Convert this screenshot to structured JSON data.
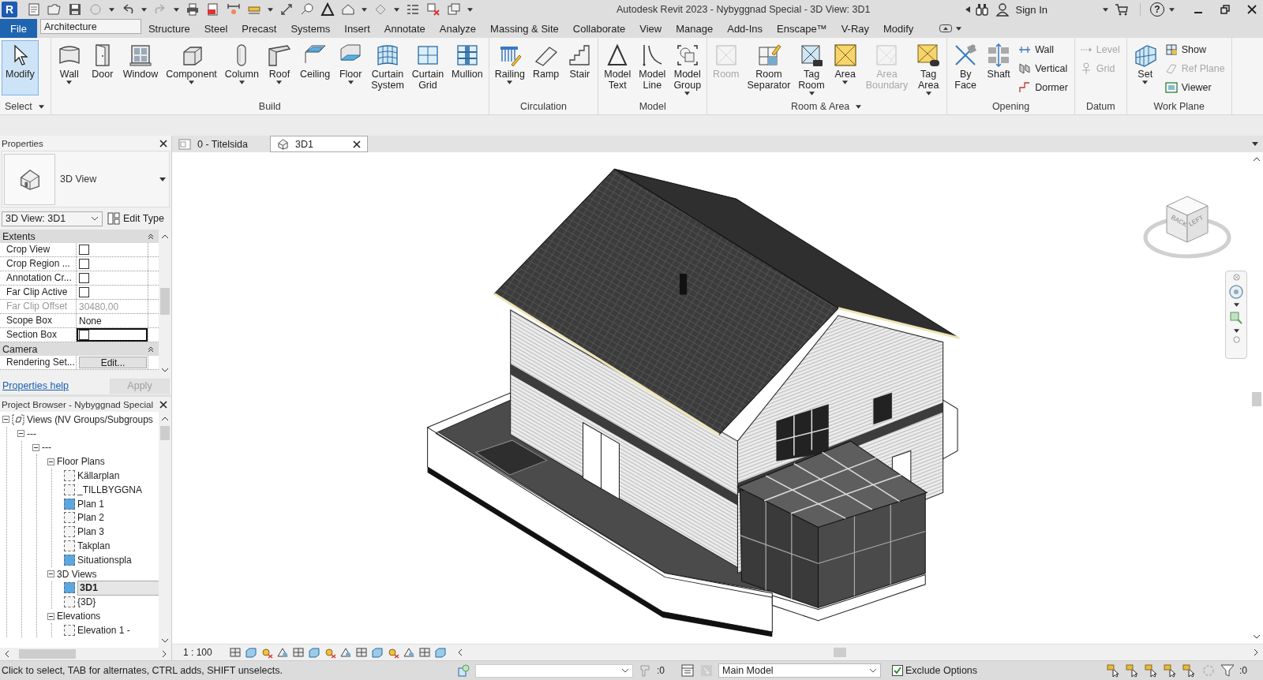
{
  "title_bar": {
    "app_logo": "R",
    "title": "Autodesk Revit 2023 - Nybyggnad Special - 3D View: 3D1",
    "sign_in": "Sign In",
    "help": "?"
  },
  "ribbon_tabs": [
    {
      "label": "File",
      "kind": "file",
      "selected": false
    },
    {
      "label": "Architecture",
      "kind": "tab",
      "selected": true
    },
    {
      "label": "Structure",
      "kind": "tab",
      "selected": false
    },
    {
      "label": "Steel",
      "kind": "tab",
      "selected": false
    },
    {
      "label": "Precast",
      "kind": "tab",
      "selected": false
    },
    {
      "label": "Systems",
      "kind": "tab",
      "selected": false
    },
    {
      "label": "Insert",
      "kind": "tab",
      "selected": false
    },
    {
      "label": "Annotate",
      "kind": "tab",
      "selected": false
    },
    {
      "label": "Analyze",
      "kind": "tab",
      "selected": false
    },
    {
      "label": "Massing & Site",
      "kind": "tab",
      "selected": false
    },
    {
      "label": "Collaborate",
      "kind": "tab",
      "selected": false
    },
    {
      "label": "View",
      "kind": "tab",
      "selected": false
    },
    {
      "label": "Manage",
      "kind": "tab",
      "selected": false
    },
    {
      "label": "Add-Ins",
      "kind": "tab",
      "selected": false
    },
    {
      "label": "Enscape™",
      "kind": "tab",
      "selected": false
    },
    {
      "label": "V-Ray",
      "kind": "tab",
      "selected": false
    },
    {
      "label": "Modify",
      "kind": "tab",
      "selected": false
    }
  ],
  "ribbon_panels": [
    {
      "label": "Select",
      "menu": true,
      "tools": [
        {
          "label": "Modify",
          "active": true,
          "disabled": false,
          "dropdown": false
        }
      ]
    },
    {
      "label": "Build",
      "menu": false,
      "tools": [
        {
          "label": "Wall",
          "active": false,
          "disabled": false,
          "dropdown": true
        },
        {
          "label": "Door",
          "active": false,
          "disabled": false,
          "dropdown": false
        },
        {
          "label": "Window",
          "active": false,
          "disabled": false,
          "dropdown": false
        },
        {
          "label": "Component",
          "active": false,
          "disabled": false,
          "dropdown": true
        },
        {
          "label": "Column",
          "active": false,
          "disabled": false,
          "dropdown": true
        },
        {
          "label": "Roof",
          "active": false,
          "disabled": false,
          "dropdown": true
        },
        {
          "label": "Ceiling",
          "active": false,
          "disabled": false,
          "dropdown": false
        },
        {
          "label": "Floor",
          "active": false,
          "disabled": false,
          "dropdown": true
        },
        {
          "label": "Curtain System",
          "active": false,
          "disabled": false,
          "dropdown": false
        },
        {
          "label": "Curtain Grid",
          "active": false,
          "disabled": false,
          "dropdown": false
        },
        {
          "label": "Mullion",
          "active": false,
          "disabled": false,
          "dropdown": false
        }
      ]
    },
    {
      "label": "Circulation",
      "menu": false,
      "tools": [
        {
          "label": "Railing",
          "active": false,
          "disabled": false,
          "dropdown": true
        },
        {
          "label": "Ramp",
          "active": false,
          "disabled": false,
          "dropdown": false
        },
        {
          "label": "Stair",
          "active": false,
          "disabled": false,
          "dropdown": false
        }
      ]
    },
    {
      "label": "Model",
      "menu": false,
      "tools": [
        {
          "label": "Model Text",
          "active": false,
          "disabled": false,
          "dropdown": false
        },
        {
          "label": "Model Line",
          "active": false,
          "disabled": false,
          "dropdown": false
        },
        {
          "label": "Model Group",
          "active": false,
          "disabled": false,
          "dropdown": true
        }
      ]
    },
    {
      "label": "Room & Area",
      "menu": true,
      "tools": [
        {
          "label": "Room",
          "active": false,
          "disabled": true,
          "dropdown": false
        },
        {
          "label": "Room Separator",
          "active": false,
          "disabled": false,
          "dropdown": false
        },
        {
          "label": "Tag Room",
          "active": false,
          "disabled": false,
          "dropdown": true
        },
        {
          "label": "Area",
          "active": false,
          "disabled": false,
          "dropdown": true
        },
        {
          "label": "Area Boundary",
          "active": false,
          "disabled": true,
          "dropdown": false
        },
        {
          "label": "Tag Area",
          "active": false,
          "disabled": false,
          "dropdown": true
        }
      ]
    },
    {
      "label": "Opening",
      "menu": false,
      "tools": [
        {
          "label": "By Face",
          "active": false,
          "disabled": false,
          "dropdown": false
        },
        {
          "label": "Shaft",
          "active": false,
          "disabled": false,
          "dropdown": false
        }
      ],
      "stack": [
        {
          "label": "Wall",
          "disabled": false
        },
        {
          "label": "Vertical",
          "disabled": false
        },
        {
          "label": "Dormer",
          "disabled": false
        }
      ]
    },
    {
      "label": "Datum",
      "menu": false,
      "stack": [
        {
          "label": "Level",
          "disabled": true
        },
        {
          "label": "Grid",
          "disabled": true
        }
      ]
    },
    {
      "label": "Work Plane",
      "menu": false,
      "tools": [
        {
          "label": "Set",
          "active": false,
          "disabled": false,
          "dropdown": true
        }
      ],
      "stack": [
        {
          "label": "Show",
          "disabled": false
        },
        {
          "label": "Ref Plane",
          "disabled": true
        },
        {
          "label": "Viewer",
          "disabled": false
        }
      ]
    }
  ],
  "properties": {
    "title": "Properties",
    "type_name": "3D View",
    "selector": "3D View: 3D1",
    "edit_type": "Edit Type",
    "groups": [
      {
        "name": "Extents",
        "expanded": true,
        "rows": [
          {
            "name": "Crop View",
            "kind": "checkbox",
            "checked": false,
            "disabled": false,
            "focused": false
          },
          {
            "name": "Crop Region ...",
            "kind": "checkbox",
            "checked": false,
            "disabled": false,
            "focused": false
          },
          {
            "name": "Annotation Cr...",
            "kind": "checkbox",
            "checked": false,
            "disabled": false,
            "focused": false
          },
          {
            "name": "Far Clip Active",
            "kind": "checkbox",
            "checked": false,
            "disabled": false,
            "focused": false
          },
          {
            "name": "Far Clip Offset",
            "kind": "text",
            "value": "30480,00",
            "disabled": true,
            "focused": false
          },
          {
            "name": "Scope Box",
            "kind": "text",
            "value": "None",
            "disabled": false,
            "focused": false
          },
          {
            "name": "Section Box",
            "kind": "checkbox",
            "checked": false,
            "disabled": false,
            "focused": true
          }
        ]
      },
      {
        "name": "Camera",
        "expanded": true,
        "rows": [
          {
            "name": "Rendering Set...",
            "kind": "button",
            "value": "Edit...",
            "disabled": false,
            "focused": false
          }
        ]
      }
    ],
    "help_link": "Properties help",
    "apply": "Apply",
    "apply_disabled": true
  },
  "view_tabs": [
    {
      "label": "0 - Titelsida",
      "kind": "sheet",
      "selected": false
    },
    {
      "label": "3D1",
      "kind": "model",
      "selected": true
    }
  ],
  "view_cube": {
    "faces": [
      "BACK",
      "LEFT"
    ]
  },
  "project_browser": {
    "title": "Project Browser - Nybyggnad Special",
    "tree": [
      {
        "label": "Views (NV Groups/Subgroups",
        "kind": "root",
        "expanded": true,
        "children": [
          {
            "label": "---",
            "kind": "group",
            "expanded": true,
            "children": [
              {
                "label": "---",
                "kind": "group",
                "expanded": true,
                "children": [
                  {
                    "label": "Floor Plans",
                    "kind": "group",
                    "expanded": true,
                    "children": [
                      {
                        "label": "Källarplan",
                        "kind": "view",
                        "on_sheet": false,
                        "selected": false
                      },
                      {
                        "label": "_TILLBYGGNA",
                        "kind": "view",
                        "on_sheet": false,
                        "selected": false
                      },
                      {
                        "label": "Plan 1",
                        "kind": "view",
                        "on_sheet": true,
                        "selected": false
                      },
                      {
                        "label": "Plan 2",
                        "kind": "view",
                        "on_sheet": false,
                        "selected": false
                      },
                      {
                        "label": "Plan 3",
                        "kind": "view",
                        "on_sheet": false,
                        "selected": false
                      },
                      {
                        "label": "Takplan",
                        "kind": "view",
                        "on_sheet": false,
                        "selected": false
                      },
                      {
                        "label": "Situationspla",
                        "kind": "view",
                        "on_sheet": true,
                        "selected": false
                      }
                    ]
                  },
                  {
                    "label": "3D Views",
                    "kind": "group",
                    "expanded": true,
                    "children": [
                      {
                        "label": "3D1",
                        "kind": "view",
                        "on_sheet": true,
                        "selected": true
                      },
                      {
                        "label": "{3D}",
                        "kind": "view",
                        "on_sheet": false,
                        "selected": false
                      }
                    ]
                  },
                  {
                    "label": "Elevations",
                    "kind": "group",
                    "expanded": true,
                    "children": [
                      {
                        "label": "Elevation 1 -",
                        "kind": "view",
                        "on_sheet": false,
                        "selected": false
                      }
                    ]
                  }
                ]
              }
            ]
          }
        ]
      }
    ]
  },
  "view_bar": {
    "scale": "1 : 100"
  },
  "status_bar": {
    "message": "Click to select, TAB for alternates, CTRL adds, SHIFT unselects.",
    "workset_count": ":0",
    "design_option": "Main Model",
    "exclude_options": {
      "label": "Exclude Options",
      "checked": true
    },
    "filter_count": ":0"
  }
}
